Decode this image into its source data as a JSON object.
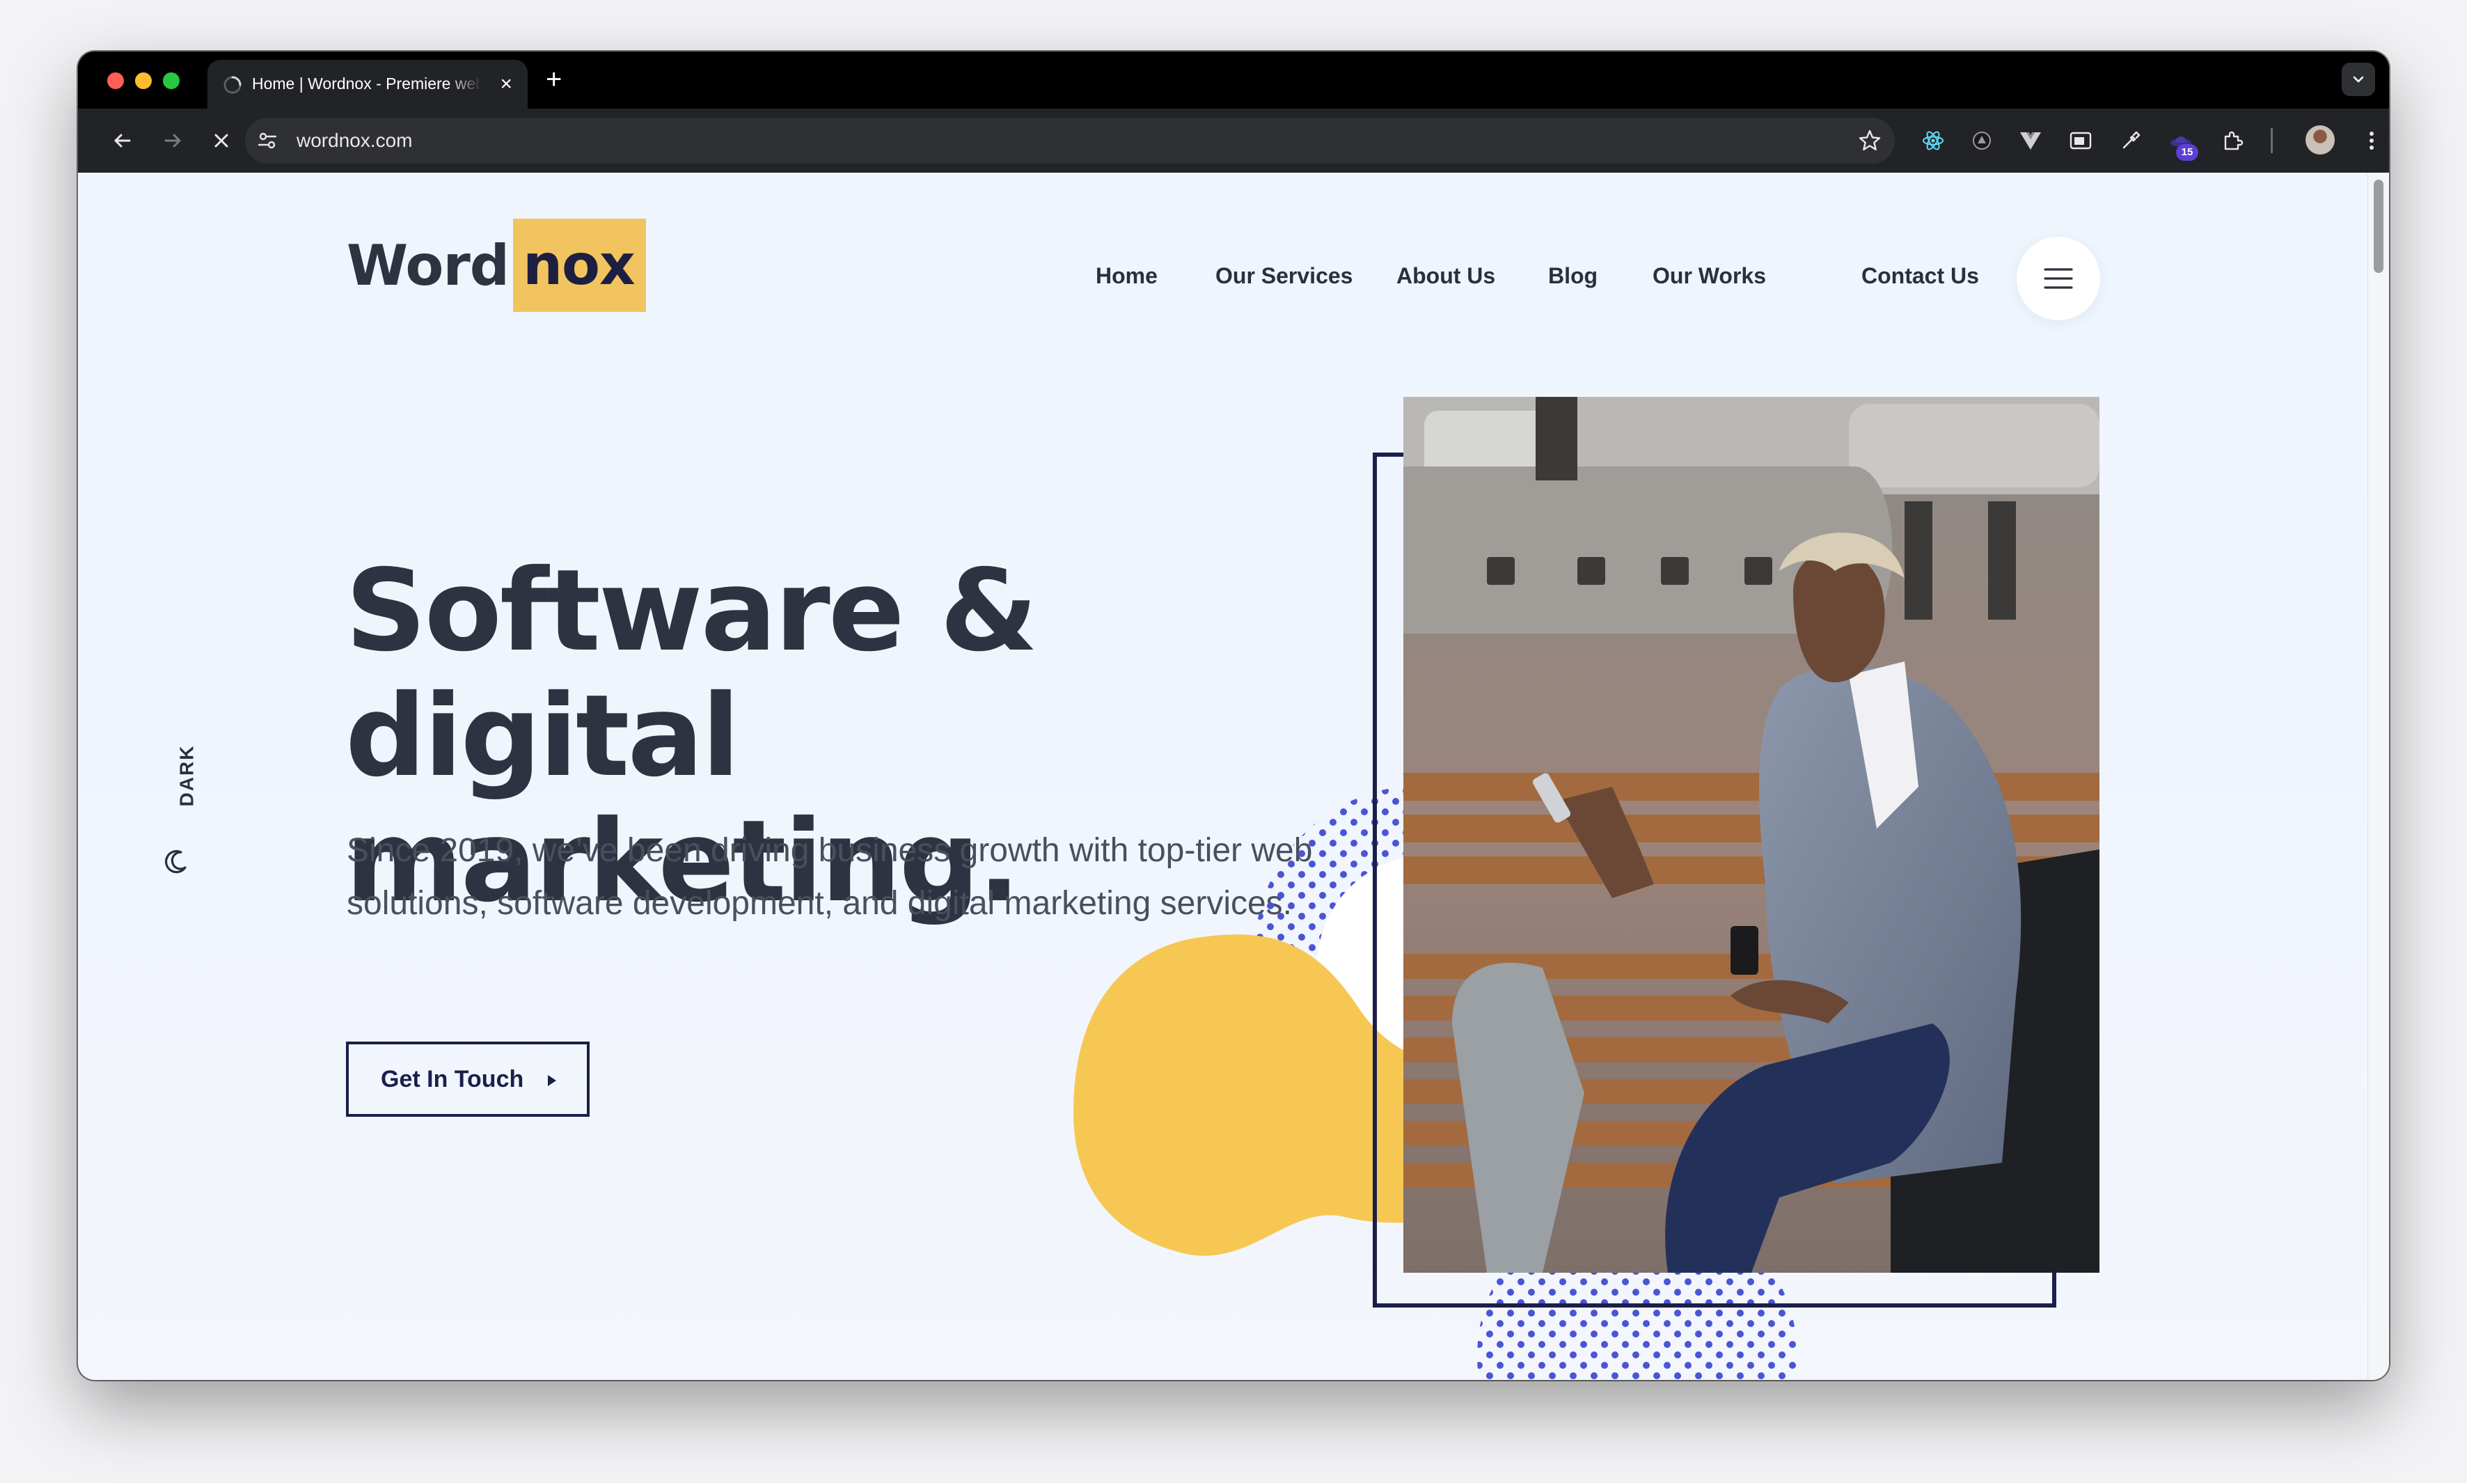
{
  "browser": {
    "tab": {
      "title": "Home | Wordnox - Premiere web solutions"
    },
    "address_bar": {
      "url": "wordnox.com"
    },
    "extension_badge": "15"
  },
  "site": {
    "logo": {
      "part1": "Word",
      "part2": "nox"
    },
    "nav": [
      "Home",
      "Our Services",
      "About Us",
      "Blog",
      "Our Works",
      "Contact Us"
    ],
    "dark_toggle_label": "DARK",
    "hero": {
      "title_line1": "Software & digital",
      "title_line2": "marketing.",
      "subtitle": "Since 2019, we’ve been driving business growth with top-tier web solutions, software development, and digital marketing services.",
      "cta_label": "Get In Touch"
    }
  },
  "colors": {
    "accent_yellow": "#f2c45f",
    "navy": "#1b1f4a",
    "text_dark": "#2f3341",
    "dots_blue": "#4a54d6",
    "page_bg": "#eef5fd"
  }
}
